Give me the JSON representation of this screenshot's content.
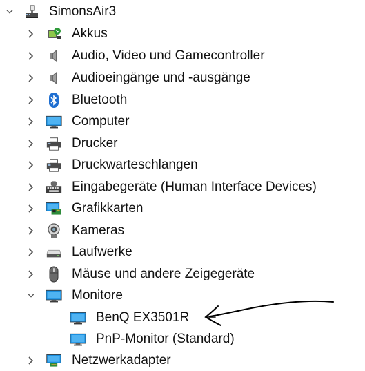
{
  "tree": {
    "root": {
      "label": "SimonsAir3",
      "icon": "computer-network-icon",
      "expanded": true
    },
    "categories": [
      {
        "label": "Akkus",
        "icon": "battery-icon",
        "expanded": false
      },
      {
        "label": "Audio, Video und Gamecontroller",
        "icon": "speaker-icon",
        "expanded": false
      },
      {
        "label": "Audioeingänge und -ausgänge",
        "icon": "speaker-icon",
        "expanded": false
      },
      {
        "label": "Bluetooth",
        "icon": "bluetooth-icon",
        "expanded": false
      },
      {
        "label": "Computer",
        "icon": "monitor-icon",
        "expanded": false
      },
      {
        "label": "Drucker",
        "icon": "printer-icon",
        "expanded": false
      },
      {
        "label": "Druckwarteschlangen",
        "icon": "printer-queue-icon",
        "expanded": false
      },
      {
        "label": "Eingabegeräte (Human Interface Devices)",
        "icon": "keyboard-icon",
        "expanded": false
      },
      {
        "label": "Grafikkarten",
        "icon": "graphics-card-icon",
        "expanded": false
      },
      {
        "label": "Kameras",
        "icon": "camera-icon",
        "expanded": false
      },
      {
        "label": "Laufwerke",
        "icon": "drive-icon",
        "expanded": false
      },
      {
        "label": "Mäuse und andere Zeigegeräte",
        "icon": "mouse-icon",
        "expanded": false
      },
      {
        "label": "Monitore",
        "icon": "monitor-icon",
        "expanded": true
      },
      {
        "label": "Netzwerkadapter",
        "icon": "network-adapter-icon",
        "expanded": false
      }
    ],
    "monitors": [
      {
        "label": "BenQ EX3501R",
        "icon": "monitor-icon"
      },
      {
        "label": "PnP-Monitor (Standard)",
        "icon": "monitor-icon"
      }
    ]
  },
  "colors": {
    "chevron": "#5a5a5a",
    "annotation": "#000000",
    "monitor_blue": "#1a8fe0"
  }
}
